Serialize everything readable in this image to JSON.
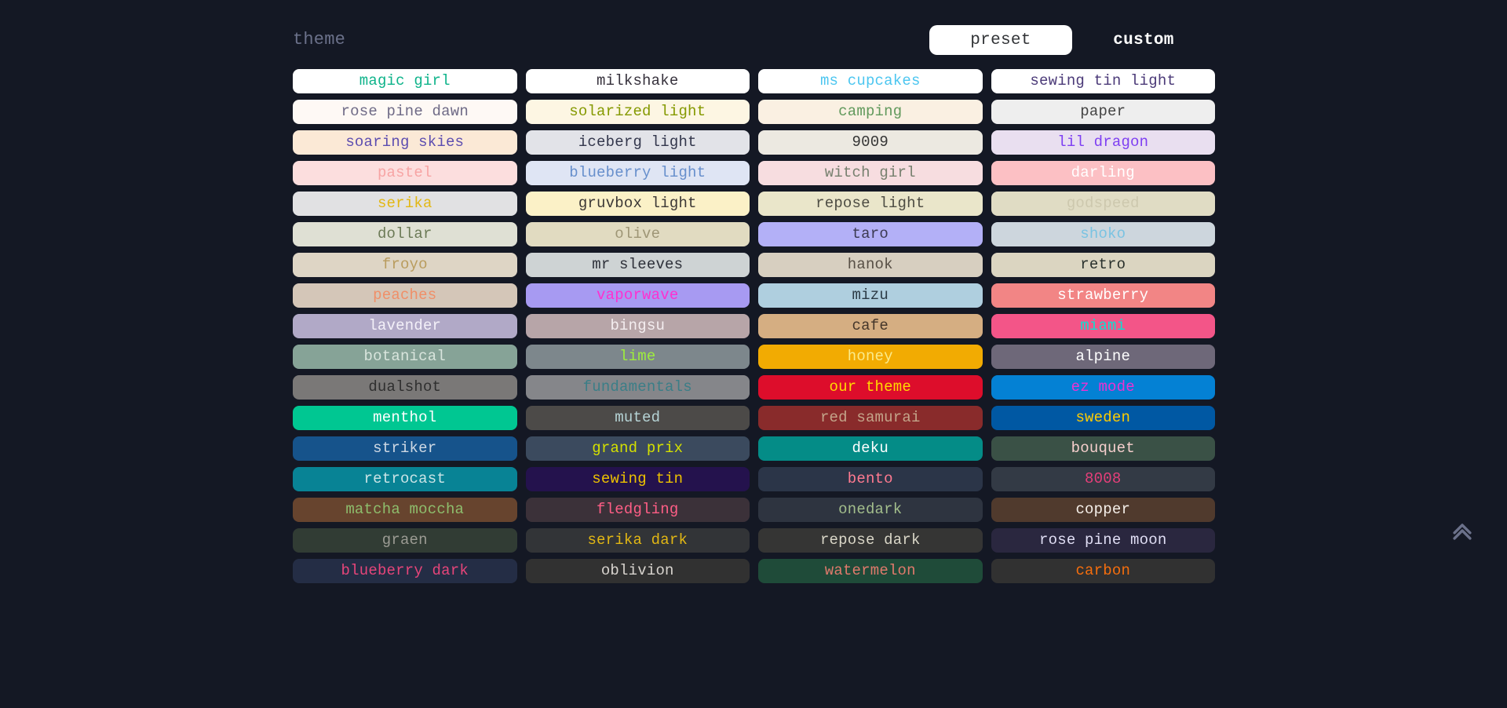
{
  "header": {
    "group_title": "theme",
    "toggle": {
      "preset_label": "preset",
      "custom_label": "custom",
      "active": "preset"
    }
  },
  "colors": {
    "page_background": "#141824",
    "muted_text": "#6b718a",
    "active_toggle_bg": "#ffffff",
    "active_toggle_text": "#323437"
  },
  "scroll_top": {
    "icon": "chevron-double-up-icon",
    "color": "#6b718a"
  },
  "themes": [
    {
      "name": "magic girl",
      "bg": "#ffffff",
      "fg": "#0eb38a"
    },
    {
      "name": "milkshake",
      "bg": "#ffffff",
      "fg": "#36313c"
    },
    {
      "name": "ms cupcakes",
      "bg": "#ffffff",
      "fg": "#4cc6f0"
    },
    {
      "name": "sewing tin light",
      "bg": "#ffffff",
      "fg": "#4b3a78"
    },
    {
      "name": "rose pine dawn",
      "bg": "#fef9f5",
      "fg": "#6e6a86"
    },
    {
      "name": "solarized light",
      "bg": "#fdf6e3",
      "fg": "#859900"
    },
    {
      "name": "camping",
      "bg": "#faf0e2",
      "fg": "#61995c"
    },
    {
      "name": "paper",
      "bg": "#eeeeee",
      "fg": "#444444"
    },
    {
      "name": "soaring skies",
      "bg": "#fbe9d6",
      "fg": "#5c4db0"
    },
    {
      "name": "iceberg light",
      "bg": "#e2e3e8",
      "fg": "#33374c"
    },
    {
      "name": "9009",
      "bg": "#ece9e1",
      "fg": "#353535"
    },
    {
      "name": "lil dragon",
      "bg": "#e9dff0",
      "fg": "#7e3ff2"
    },
    {
      "name": "pastel",
      "bg": "#fcdede",
      "fg": "#f7a4a4"
    },
    {
      "name": "blueberry light",
      "bg": "#dfe5f4",
      "fg": "#678fcc"
    },
    {
      "name": "witch girl",
      "bg": "#f7dde0",
      "fg": "#77806f"
    },
    {
      "name": "darling",
      "bg": "#fcc0c4",
      "fg": "#ffffff"
    },
    {
      "name": "serika",
      "bg": "#e1e1e3",
      "fg": "#e2b714"
    },
    {
      "name": "gruvbox light",
      "bg": "#fbf1c7",
      "fg": "#3c3836"
    },
    {
      "name": "repose light",
      "bg": "#eae6ca",
      "fg": "#4d4c43"
    },
    {
      "name": "godspeed",
      "bg": "#e0dcc4",
      "fg": "#cdc8ae"
    },
    {
      "name": "dollar",
      "bg": "#dfe0d4",
      "fg": "#6c7a57"
    },
    {
      "name": "olive",
      "bg": "#e1dbc1",
      "fg": "#9e9676"
    },
    {
      "name": "taro",
      "bg": "#b3b0f7",
      "fg": "#3c3a52"
    },
    {
      "name": "shoko",
      "bg": "#cdd6dd",
      "fg": "#7ac3e2"
    },
    {
      "name": "froyo",
      "bg": "#ded5c5",
      "fg": "#b99c5e"
    },
    {
      "name": "mr sleeves",
      "bg": "#ced3d4",
      "fg": "#2d3039"
    },
    {
      "name": "hanok",
      "bg": "#d7cfc0",
      "fg": "#574f45"
    },
    {
      "name": "retro",
      "bg": "#dbd5c1",
      "fg": "#29302c"
    },
    {
      "name": "peaches",
      "bg": "#d4c6b8",
      "fg": "#f08f68"
    },
    {
      "name": "vaporwave",
      "bg": "#a79af2",
      "fg": "#ff2fd0"
    },
    {
      "name": "mizu",
      "bg": "#afcfdf",
      "fg": "#2b3a45"
    },
    {
      "name": "strawberry",
      "bg": "#f28585",
      "fg": "#ffffff"
    },
    {
      "name": "lavender",
      "bg": "#b1a9c7",
      "fg": "#f4f1f9"
    },
    {
      "name": "bingsu",
      "bg": "#b7a5a8",
      "fg": "#f4eef0"
    },
    {
      "name": "cafe",
      "bg": "#d5ae82",
      "fg": "#44362a"
    },
    {
      "name": "miami",
      "bg": "#f35588",
      "fg": "#0be0d2"
    },
    {
      "name": "botanical",
      "bg": "#86a397",
      "fg": "#d9e5dd"
    },
    {
      "name": "lime",
      "bg": "#7d878c",
      "fg": "#9eed3d"
    },
    {
      "name": "honey",
      "bg": "#f2ab02",
      "fg": "#fbeb8b"
    },
    {
      "name": "alpine",
      "bg": "#6e6879",
      "fg": "#ffffff"
    },
    {
      "name": "dualshot",
      "bg": "#7a7877",
      "fg": "#2f2f2f"
    },
    {
      "name": "fundamentals",
      "bg": "#85868a",
      "fg": "#3b7e87"
    },
    {
      "name": "our theme",
      "bg": "#dd0d2b",
      "fg": "#ffdb00"
    },
    {
      "name": "ez mode",
      "bg": "#0481d4",
      "fg": "#ee31d2"
    },
    {
      "name": "menthol",
      "bg": "#00c792",
      "fg": "#ffffff"
    },
    {
      "name": "muted",
      "bg": "#4c4a48",
      "fg": "#b6d4d6"
    },
    {
      "name": "red samurai",
      "bg": "#892b2b",
      "fg": "#c4a58a"
    },
    {
      "name": "sweden",
      "bg": "#0058a3",
      "fg": "#ffcc00"
    },
    {
      "name": "striker",
      "bg": "#16538b",
      "fg": "#cfd9e4"
    },
    {
      "name": "grand prix",
      "bg": "#3b4a5e",
      "fg": "#d4e000"
    },
    {
      "name": "deku",
      "bg": "#048c87",
      "fg": "#ffffff"
    },
    {
      "name": "bouquet",
      "bg": "#3a5146",
      "fg": "#f6cfcd"
    },
    {
      "name": "retrocast",
      "bg": "#088395",
      "fg": "#cbe4e6"
    },
    {
      "name": "sewing tin",
      "bg": "#24124d",
      "fg": "#edc200"
    },
    {
      "name": "bento",
      "bg": "#2b3548",
      "fg": "#ff7a90"
    },
    {
      "name": "8008",
      "bg": "#333a45",
      "fg": "#e63f7a"
    },
    {
      "name": "matcha moccha",
      "bg": "#67442e",
      "fg": "#8ebe6d"
    },
    {
      "name": "fledgling",
      "bg": "#3b3139",
      "fg": "#ff5e86"
    },
    {
      "name": "onedark",
      "bg": "#2e3440",
      "fg": "#a3be8c"
    },
    {
      "name": "copper",
      "bg": "#503a2d",
      "fg": "#f6f0ea"
    },
    {
      "name": "graen",
      "bg": "#313c34",
      "fg": "#9b9b93"
    },
    {
      "name": "serika dark",
      "bg": "#323437",
      "fg": "#e2b714"
    },
    {
      "name": "repose dark",
      "bg": "#353534",
      "fg": "#dad7c8"
    },
    {
      "name": "rose pine moon",
      "bg": "#2a273f",
      "fg": "#e0def4"
    },
    {
      "name": "blueberry dark",
      "bg": "#242d45",
      "fg": "#e7457a"
    },
    {
      "name": "oblivion",
      "bg": "#313131",
      "fg": "#d8d4cf"
    },
    {
      "name": "watermelon",
      "bg": "#1f4b39",
      "fg": "#e07a6c"
    },
    {
      "name": "carbon",
      "bg": "#313131",
      "fg": "#f66e0d"
    }
  ]
}
